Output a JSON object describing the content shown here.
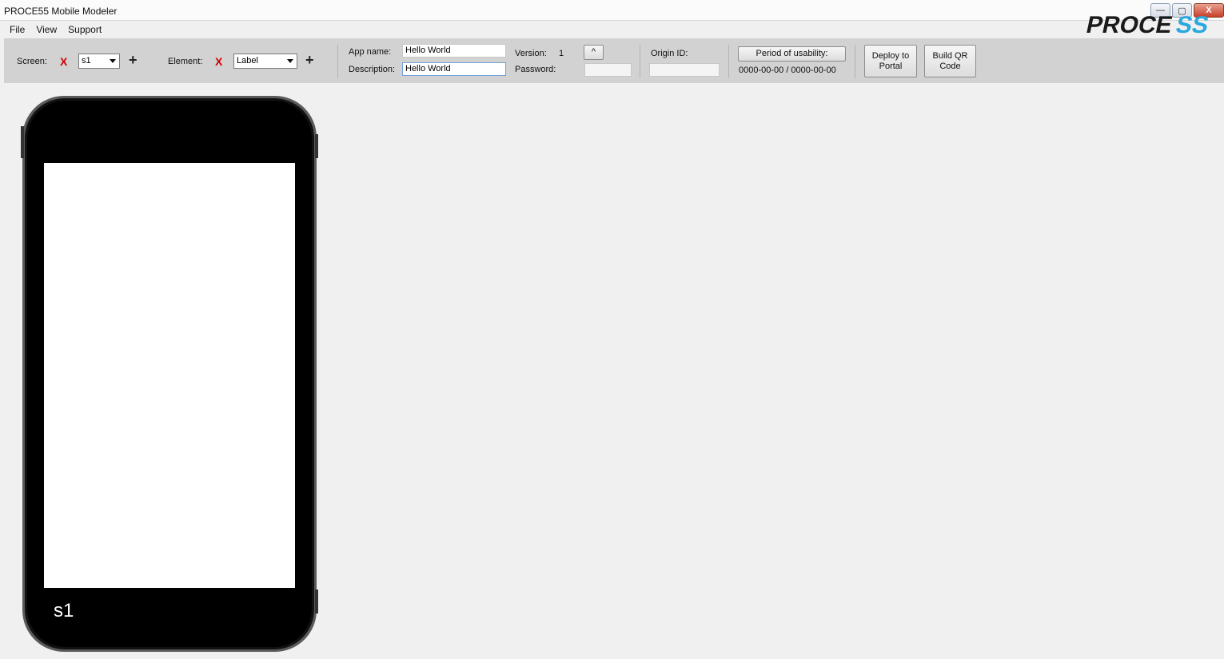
{
  "window": {
    "title": "PROCE55 Mobile Modeler",
    "controls": {
      "minimize": "—",
      "maximize": "▢",
      "close": "X"
    }
  },
  "menu": [
    "File",
    "View",
    "Support"
  ],
  "toolbar": {
    "screen_label": "Screen:",
    "delete_screen": "X",
    "screen_value": "s1",
    "add_screen": "+",
    "element_label": "Element:",
    "delete_element": "X",
    "element_value": "Label",
    "add_element": "+",
    "app_name_label": "App name:",
    "app_name_value": "Hello World",
    "description_label": "Description:",
    "description_value": "Hello World",
    "version_label": "Version:",
    "version_value": "1",
    "version_up": "^",
    "password_label": "Password:",
    "password_value": "",
    "origin_id_label": "Origin ID:",
    "origin_id_value": "",
    "period_button": "Period of usability:",
    "period_value": "0000-00-00 /  0000-00-00",
    "deploy_line1": "Deploy to",
    "deploy_line2": "Portal",
    "qr_line1": "Build QR",
    "qr_line2": "Code"
  },
  "logo": {
    "text_dark": "PROCE",
    "text_accent": "SS",
    "accent_color": "#2aa8e0"
  },
  "phone": {
    "screen_name": "s1"
  }
}
